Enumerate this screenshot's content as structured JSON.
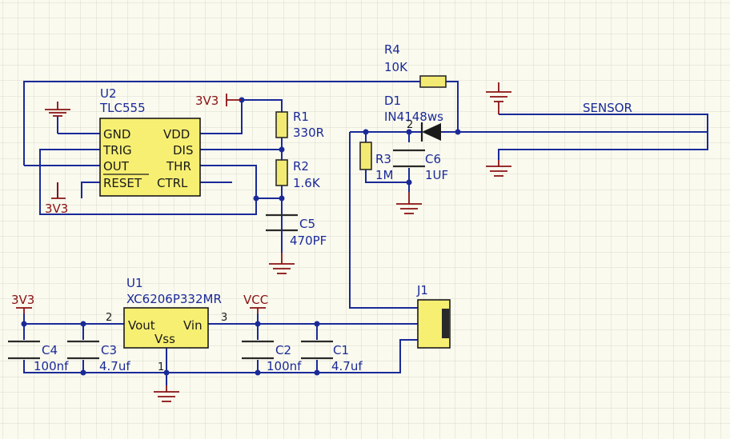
{
  "u2": {
    "ref": "U2",
    "part": "TLC555",
    "pins": {
      "gnd": "GND",
      "vdd": "VDD",
      "trig": "TRIG",
      "dis": "DIS",
      "out": "OUT",
      "thr": "THR",
      "reset": "RESET",
      "ctrl": "CTRL"
    }
  },
  "u1": {
    "ref": "U1",
    "part": "XC6206P332MR",
    "pins": {
      "vout": "Vout",
      "vin": "Vin",
      "vss": "Vss"
    },
    "pin_numbers": {
      "vout": "2",
      "vin": "3",
      "vss": "1"
    }
  },
  "resistors": {
    "r1": {
      "ref": "R1",
      "value": "330R"
    },
    "r2": {
      "ref": "R2",
      "value": "1.6K"
    },
    "r3": {
      "ref": "R3",
      "value": "1M"
    },
    "r4": {
      "ref": "R4",
      "value": "10K"
    }
  },
  "capacitors": {
    "c1": {
      "ref": "C1",
      "value": "4.7uf"
    },
    "c2": {
      "ref": "C2",
      "value": "100nf"
    },
    "c3": {
      "ref": "C3",
      "value": "4.7uf"
    },
    "c4": {
      "ref": "C4",
      "value": "100nf"
    },
    "c5": {
      "ref": "C5",
      "value": "470PF"
    },
    "c6": {
      "ref": "C6",
      "value": "1UF"
    }
  },
  "diode": {
    "ref": "D1",
    "part": "IN4148ws",
    "pin_number": "2"
  },
  "connector": {
    "ref": "J1"
  },
  "power": {
    "v3v3_a": "3V3",
    "v3v3_b": "3V3",
    "v3v3_c": "3V3",
    "vcc": "VCC"
  },
  "nets": {
    "sensor": "SENSOR"
  },
  "colors": {
    "wire": "#1a2a98",
    "power": "#8a1212",
    "ic_fill": "#f7ef72",
    "grid": "#d9d9cc",
    "background": "#fafaef"
  }
}
